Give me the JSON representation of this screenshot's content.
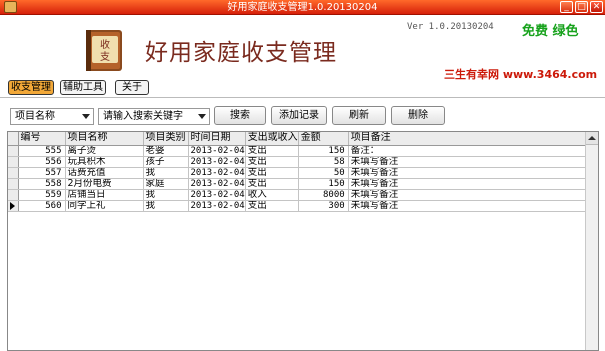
{
  "window": {
    "title": "好用家庭收支管理1.0.20130204"
  },
  "header": {
    "app_name": "好用家庭收支管理",
    "logo_text": "收支",
    "version": "Ver 1.0.20130204",
    "free_badge": "免费 绿色",
    "site": "三生有幸网 www.3464.com"
  },
  "menu": {
    "tabs": [
      {
        "label": "收支管理",
        "active": true
      },
      {
        "label": "辅助工具"
      },
      {
        "label": "关于"
      }
    ]
  },
  "toolbar": {
    "field_select": "项目名称",
    "keyword_select": "请输入搜索关键字",
    "search_button": "搜索",
    "add_button": "添加记录",
    "refresh_button": "刷新",
    "delete_button": "删除"
  },
  "table": {
    "columns": [
      "编号",
      "项目名称",
      "项目类别",
      "时间日期",
      "支出或收入",
      "金额",
      "项目备注"
    ],
    "rows": [
      {
        "id": "555",
        "name": "离子烫",
        "category": "老婆",
        "date": "2013-02-04",
        "type": "支出",
        "amount": "150",
        "note": "备注："
      },
      {
        "id": "556",
        "name": "玩具积木",
        "category": "孩子",
        "date": "2013-02-04",
        "type": "支出",
        "amount": "58",
        "note": "未填写备注"
      },
      {
        "id": "557",
        "name": "话费充值",
        "category": "我",
        "date": "2013-02-04",
        "type": "支出",
        "amount": "50",
        "note": "未填写备注"
      },
      {
        "id": "558",
        "name": "2月份电费",
        "category": "家庭",
        "date": "2013-02-04",
        "type": "支出",
        "amount": "150",
        "note": "未填写备注"
      },
      {
        "id": "559",
        "name": "店铺当日",
        "category": "我",
        "date": "2013-02-04",
        "type": "收入",
        "amount": "8000",
        "note": "未填写备注"
      },
      {
        "id": "560",
        "name": "同学上礼",
        "category": "我",
        "date": "2013-02-04",
        "type": "支出",
        "amount": "300",
        "note": "未填写备注"
      }
    ],
    "current_row_index": 5
  },
  "colors": {
    "titlebar": "#d6200a",
    "active_tab": "#f2a838",
    "free_badge": "#17a21c",
    "site": "#cc1a0a",
    "app_name": "#7a2a1e"
  },
  "icons": {
    "window": "app-book-icon",
    "minimize": "minimize-icon",
    "maximize": "maximize-icon",
    "close": "close-icon"
  }
}
